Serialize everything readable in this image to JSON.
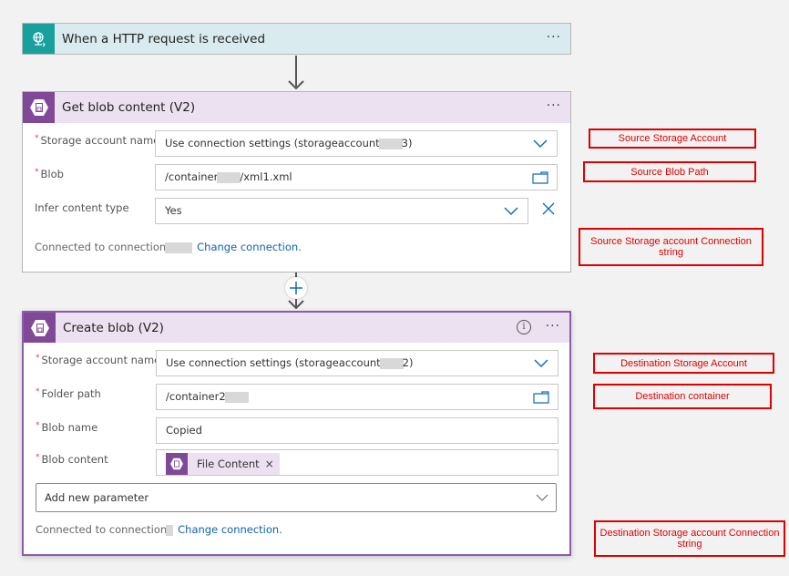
{
  "trigger": {
    "title": "When a HTTP request is received",
    "icon": "globe-request-icon",
    "menu": "···"
  },
  "get_blob": {
    "title": "Get blob content (V2)",
    "icon": "blob-storage-icon",
    "menu": "···",
    "fields": [
      {
        "label": "Storage account name",
        "required": true,
        "value_prefix": "Use connection settings (storageaccount",
        "value_suffix": "3)",
        "control": "dropdown"
      },
      {
        "label": "Blob",
        "required": true,
        "value_prefix": "/container",
        "value_suffix": "/xml1.xml",
        "control": "file-picker"
      },
      {
        "label": "Infer content type",
        "required": false,
        "value": "Yes",
        "control": "dropdown"
      }
    ],
    "connected_text": "Connected to connection",
    "change_connection": "Change connection."
  },
  "create_blob": {
    "title": "Create blob (V2)",
    "icon": "blob-storage-icon",
    "menu": "···",
    "info": "i",
    "fields": [
      {
        "label": "Storage account name",
        "required": true,
        "value_prefix": "Use connection settings (storageaccount",
        "value_suffix": "2)",
        "control": "dropdown"
      },
      {
        "label": "Folder path",
        "required": true,
        "value_prefix": "/container2",
        "value_suffix": "",
        "control": "file-picker"
      },
      {
        "label": "Blob name",
        "required": true,
        "value": "Copied",
        "control": "text"
      },
      {
        "label": "Blob content",
        "required": true,
        "token": "File Content",
        "token_remove": "×",
        "control": "token"
      }
    ],
    "add_parameter": "Add new parameter",
    "connected_text": "Connected to connection",
    "change_connection": "Change connection."
  },
  "required_mark": "*",
  "annotations": [
    {
      "text": "Source Storage Account"
    },
    {
      "text": "Source Blob Path"
    },
    {
      "text": "Source Storage account Connection string"
    },
    {
      "text": "Destination Storage Account"
    },
    {
      "text": "Destination container"
    },
    {
      "text": "Destination Storage account Connection string"
    }
  ],
  "colors": {
    "trigger_accent": "#17a09c",
    "trigger_header": "#d9ebee",
    "blob_accent": "#804998",
    "blob_header": "#ebe1f0",
    "link": "#0f62ac",
    "annotation": "#e00000",
    "required": "#e0414e"
  }
}
